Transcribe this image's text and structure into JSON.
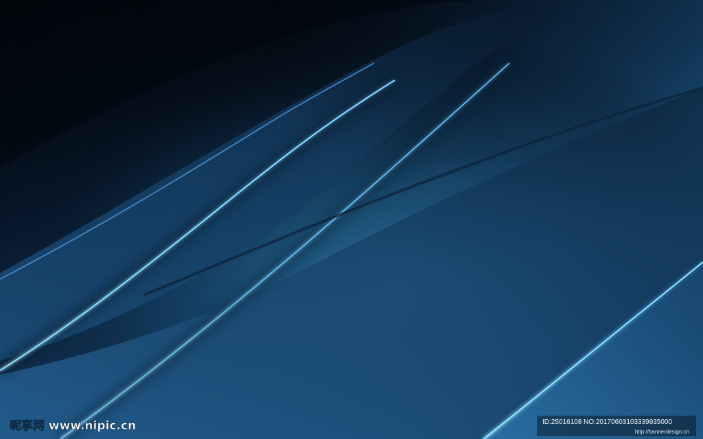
{
  "scene": {
    "background_colors": [
      "#030911",
      "#0a2038",
      "#184a70",
      "#2b77a8",
      "#7fd1ff"
    ],
    "elements": [
      "dark-gradient-background",
      "flowing-blue-ribbon-bands",
      "bright-cyan-highlight-edges"
    ]
  },
  "watermark": {
    "brand_text": "昵享网 www.nipic.cn",
    "id_text": "ID:25016108 NO:20170603103339935000",
    "source_url": "http://bannerdesign.cn"
  }
}
